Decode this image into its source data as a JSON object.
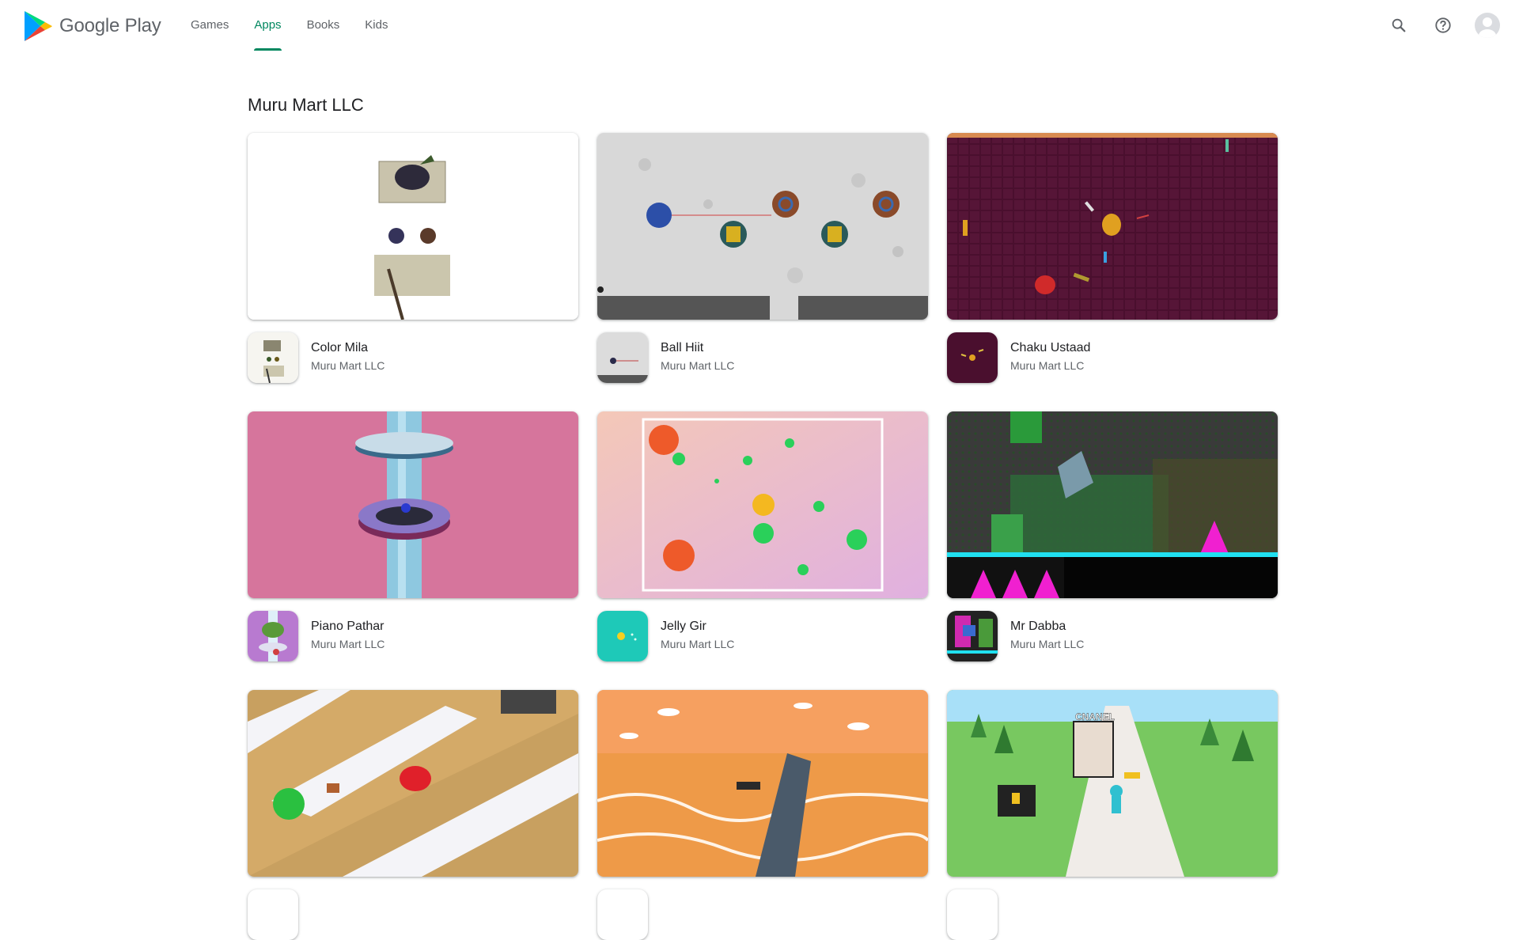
{
  "header": {
    "brand": "Google Play",
    "nav": [
      {
        "label": "Games",
        "active": false
      },
      {
        "label": "Apps",
        "active": true
      },
      {
        "label": "Books",
        "active": false
      },
      {
        "label": "Kids",
        "active": false
      }
    ],
    "icons": [
      "search-icon",
      "help-icon",
      "account-avatar"
    ]
  },
  "main": {
    "title": "Muru Mart LLC",
    "apps": [
      {
        "name": "Color Mila",
        "developer": "Muru Mart LLC"
      },
      {
        "name": "Ball Hiit",
        "developer": "Muru Mart LLC"
      },
      {
        "name": "Chaku Ustaad",
        "developer": "Muru Mart LLC"
      },
      {
        "name": "Piano Pathar",
        "developer": "Muru Mart LLC"
      },
      {
        "name": "Jelly Gir",
        "developer": "Muru Mart LLC"
      },
      {
        "name": "Mr Dabba",
        "developer": "Muru Mart LLC"
      },
      {
        "name": "",
        "developer": ""
      },
      {
        "name": "",
        "developer": ""
      },
      {
        "name": "",
        "developer": ""
      }
    ],
    "shot_texts": {
      "cnanel": "CNANEL"
    }
  },
  "colors": {
    "accent": "#01875f",
    "text_primary": "#202124",
    "text_secondary": "#5f6368"
  }
}
